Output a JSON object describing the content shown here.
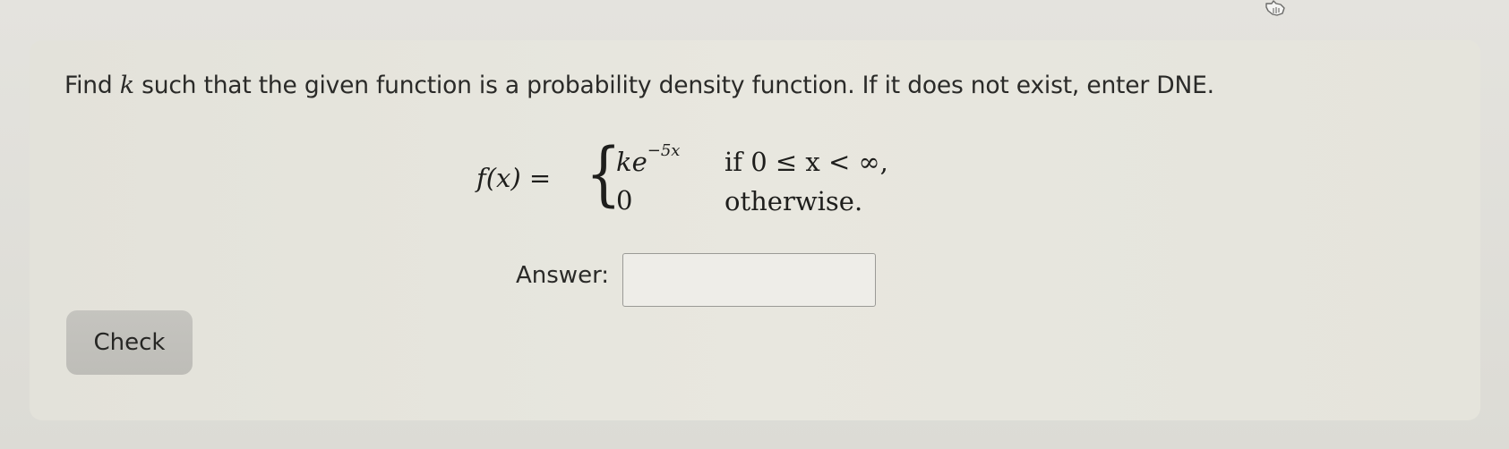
{
  "question": {
    "prefix": "Find ",
    "variable": "k",
    "suffix": " such that the given function is a probability density function. If it does not exist, enter DNE."
  },
  "equation": {
    "lhs": "f(x) =",
    "case1_value": "ke",
    "case1_exponent": "−5x",
    "case1_condition": "if 0 ≤ x < ∞,",
    "case2_value": "0",
    "case2_condition": "otherwise."
  },
  "answer": {
    "label": "Answer:",
    "value": "",
    "placeholder": ""
  },
  "buttons": {
    "check_label": "Check"
  },
  "icons": {
    "cursor": "hand-pointer-icon"
  },
  "colors": {
    "background": "#e4e3de",
    "panel": "#e6e5dd",
    "button": "#c2c1bc",
    "text": "#2a2a28"
  }
}
